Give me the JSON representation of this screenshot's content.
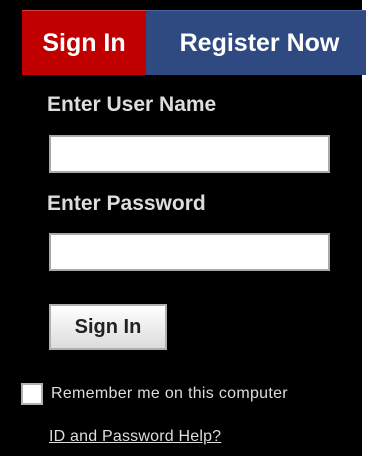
{
  "tabs": {
    "sign_in": "Sign In",
    "register": "Register Now"
  },
  "form": {
    "username_label": "Enter User Name",
    "username_value": "",
    "password_label": "Enter Password",
    "password_value": "",
    "submit_label": "Sign In",
    "remember_label": "Remember me on this computer",
    "remember_checked": false,
    "help_link": "ID and Password Help?"
  },
  "colors": {
    "panel_background": "#000000",
    "sign_in_tab": "#c00000",
    "register_tab": "#2e4a80",
    "text": "#dddddd"
  }
}
